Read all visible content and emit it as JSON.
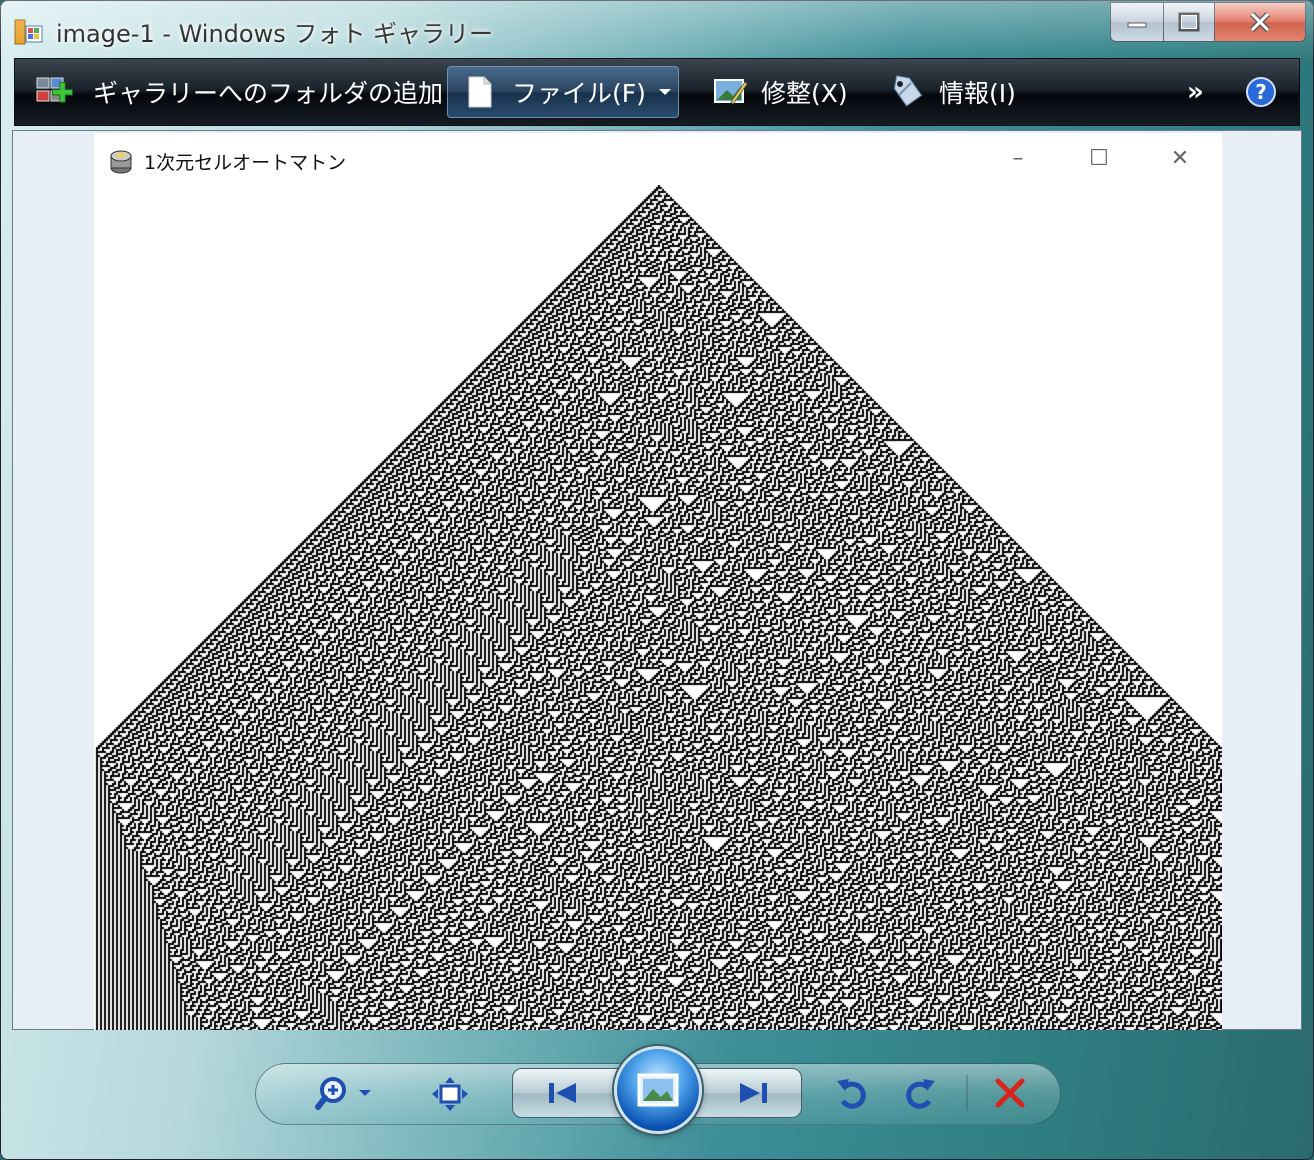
{
  "window": {
    "title": "image-1 - Windows フォト ギャラリー",
    "icon": "photo-gallery-icon"
  },
  "toolbar": {
    "add_folder_label": "ギャラリーへのフォルダの追加",
    "file_label": "ファイル(F)",
    "fix_label": "修整(X)",
    "info_label": "情報(I)",
    "more_label": "»",
    "help_label": "?"
  },
  "photo": {
    "window_title": "1次元セルオートマトン",
    "content": "cellular-automaton-rule-30-pattern"
  },
  "controls": {
    "items": [
      "zoom-icon",
      "fit-to-window-icon",
      "previous-icon",
      "slideshow-icon",
      "next-icon",
      "rotate-counterclockwise-icon",
      "rotate-clockwise-icon",
      "delete-icon"
    ]
  },
  "colors": {
    "accent": "#0a4fb0",
    "delete": "#d8241c",
    "toolbar": "#151c24"
  }
}
